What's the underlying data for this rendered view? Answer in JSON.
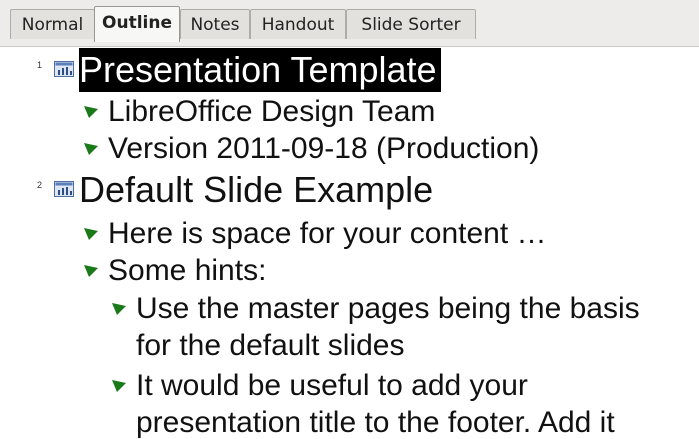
{
  "tabs": [
    {
      "label": "Normal"
    },
    {
      "label": "Outline"
    },
    {
      "label": "Notes"
    },
    {
      "label": "Handout"
    },
    {
      "label": "Slide Sorter"
    }
  ],
  "active_tab": "Outline",
  "outline": {
    "slides": [
      {
        "number": "1",
        "title": "Presentation Template",
        "selected": true,
        "items": [
          {
            "text": "LibreOffice Design Team"
          },
          {
            "text": "Version 2011-09-18 (Production)"
          }
        ]
      },
      {
        "number": "2",
        "title": "Default Slide Example",
        "selected": false,
        "items": [
          {
            "text": "Here is space for your content …"
          },
          {
            "text": "Some hints:"
          },
          {
            "text": "Use the master pages being the basis"
          },
          {
            "text": "for the default slides"
          },
          {
            "text": "It would be useful to add your"
          },
          {
            "text": "presentation title to the footer. Add it"
          }
        ]
      }
    ]
  },
  "colors": {
    "bullet": "#1a7a1a",
    "selection": "#000000",
    "tabbar": "#edecea"
  }
}
